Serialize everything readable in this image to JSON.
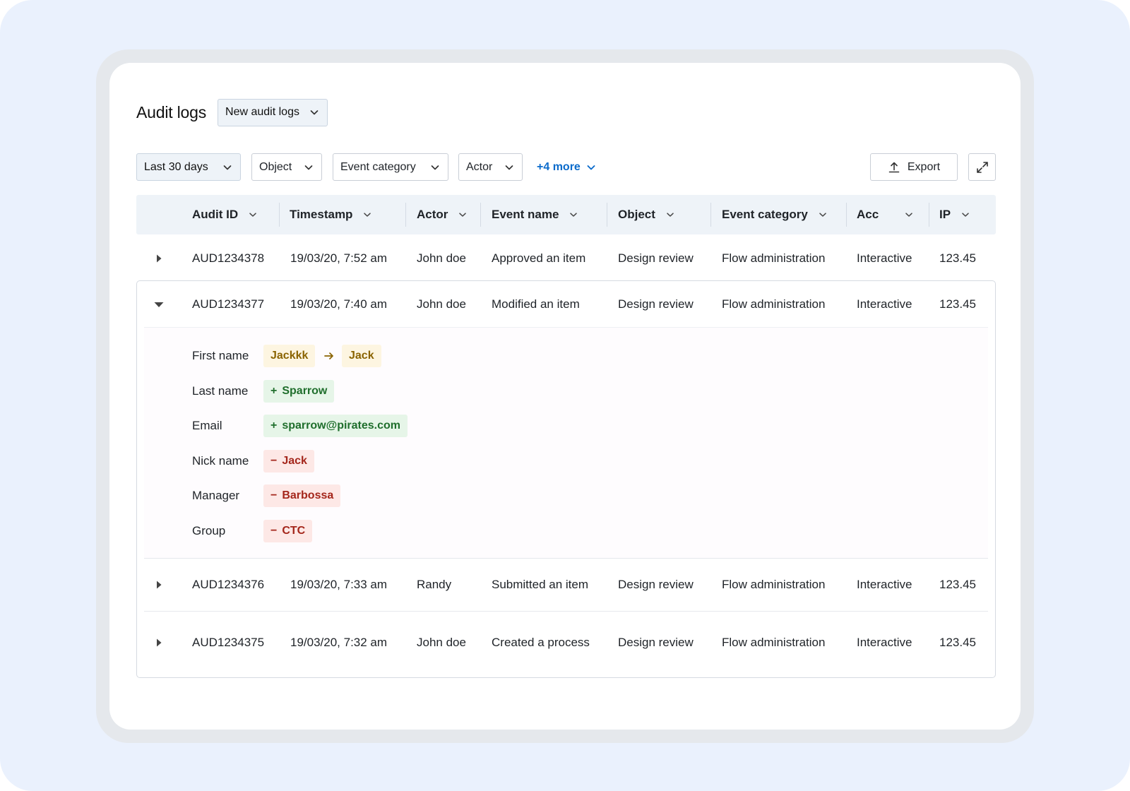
{
  "header": {
    "title": "Audit logs",
    "view_select": "New audit logs"
  },
  "filters": [
    {
      "label": "Last 30 days",
      "active": true
    },
    {
      "label": "Object",
      "active": false
    },
    {
      "label": "Event category",
      "active": false
    },
    {
      "label": "Actor",
      "active": false
    }
  ],
  "more_filters": "+4 more",
  "export_label": "Export",
  "columns": [
    "Audit ID",
    "Timestamp",
    "Actor",
    "Event name",
    "Object",
    "Event category",
    "Acc",
    "IP"
  ],
  "rows": [
    {
      "audit_id": "AUD1234378",
      "timestamp": "19/03/20, 7:52 am",
      "actor": "John doe",
      "event": "Approved an item",
      "object": "Design review",
      "category": "Flow administration",
      "acc": "Interactive",
      "ip": "123.45",
      "expanded": false
    },
    {
      "audit_id": "AUD1234377",
      "timestamp": "19/03/20, 7:40 am",
      "actor": "John doe",
      "event": "Modified an item",
      "object": "Design review",
      "category": "Flow administration",
      "acc": "Interactive",
      "ip": "123.45",
      "expanded": true
    },
    {
      "audit_id": "AUD1234376",
      "timestamp": "19/03/20, 7:33 am",
      "actor": "Randy",
      "event": "Submitted an item",
      "object": "Design review",
      "category": "Flow administration",
      "acc": "Interactive",
      "ip": "123.45",
      "expanded": false
    },
    {
      "audit_id": "AUD1234375",
      "timestamp": "19/03/20, 7:32 am",
      "actor": "John doe",
      "event": "Created a process",
      "object": "Design review",
      "category": "Flow administration",
      "acc": "Interactive",
      "ip": "123.45",
      "expanded": false
    }
  ],
  "details": [
    {
      "label": "First name",
      "type": "modified",
      "from": "Jackkk",
      "to": "Jack"
    },
    {
      "label": "Last name",
      "type": "added",
      "prefix": "+",
      "value": "Sparrow"
    },
    {
      "label": "Email",
      "type": "added",
      "prefix": "+",
      "value": "sparrow@pirates.com"
    },
    {
      "label": "Nick name",
      "type": "removed",
      "prefix": "−",
      "value": "Jack"
    },
    {
      "label": "Manager",
      "type": "removed",
      "prefix": "−",
      "value": "Barbossa"
    },
    {
      "label": "Group",
      "type": "removed",
      "prefix": "−",
      "value": "CTC"
    }
  ],
  "colors": {
    "background": "#eaf1fd",
    "accent_link": "#0b6bcb",
    "modified": "#8a6300",
    "added": "#1f6e2c",
    "removed": "#a4261b"
  }
}
